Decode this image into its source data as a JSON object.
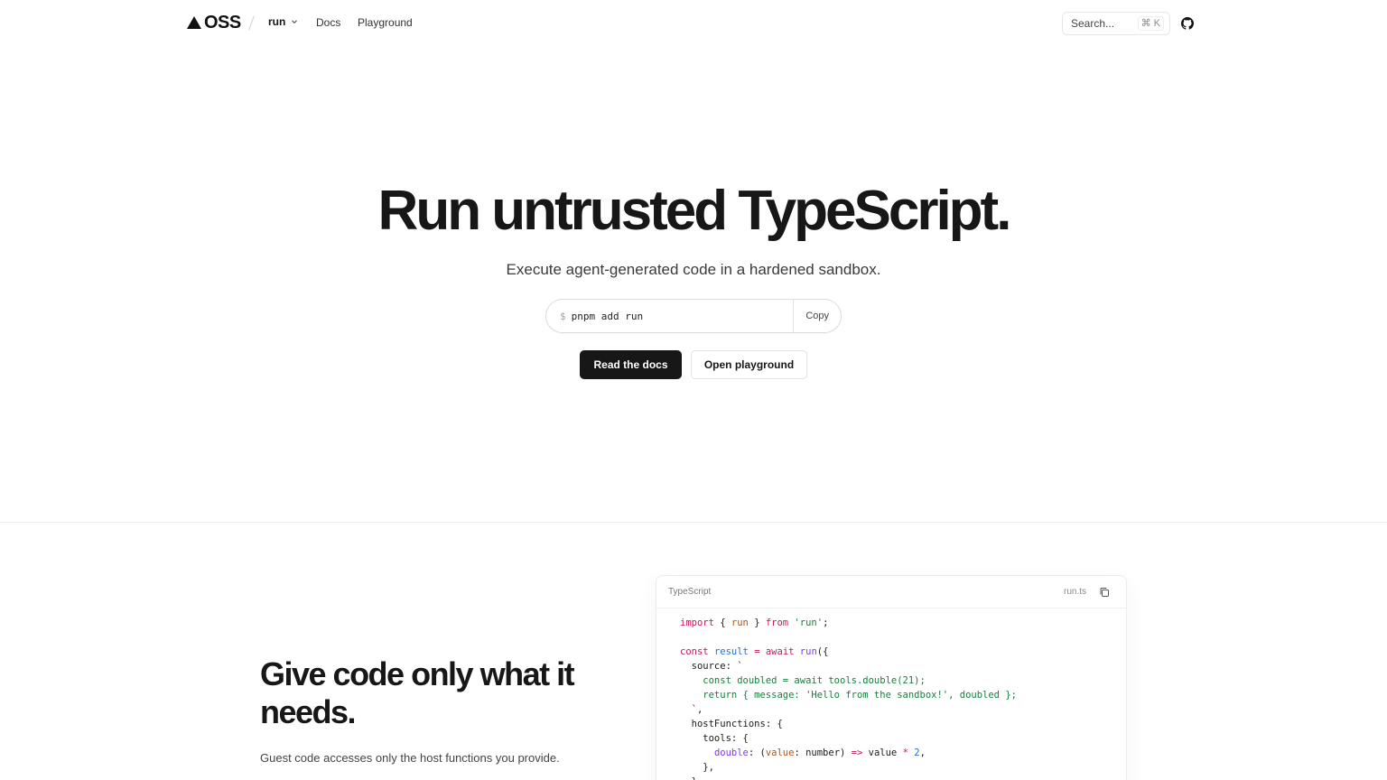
{
  "header": {
    "logo_text": "OSS",
    "project": "run",
    "nav": [
      {
        "label": "Docs"
      },
      {
        "label": "Playground"
      }
    ],
    "search": {
      "placeholder": "Search...",
      "shortcut_mod": "⌘",
      "shortcut_key": "K"
    },
    "github_icon": "github-icon"
  },
  "hero": {
    "title": "Run untrusted TypeScript.",
    "subtitle": "Execute agent-generated code in a hardened sandbox.",
    "install": {
      "prompt": "$",
      "command": "pnpm add run",
      "copy_label": "Copy"
    },
    "primary_cta": "Read the docs",
    "secondary_cta": "Open playground"
  },
  "feature": {
    "title": "Give code only what it needs.",
    "description": "Guest code accesses only the host functions you provide."
  },
  "code_card": {
    "language": "TypeScript",
    "filename": "run.ts",
    "lines": [
      "import { run } from 'run';",
      "",
      "const result = await run({",
      "  source: `",
      "    const doubled = await tools.double(21);",
      "    return { message: 'Hello from the sandbox!', doubled };",
      "  `,",
      "  hostFunctions: {",
      "    tools: {",
      "      double: (value: number) => value * 2,",
      "    },",
      "  },"
    ]
  },
  "colors": {
    "text": "#171717",
    "primary_button": "#171717",
    "keyword": "#c2185b",
    "string": "#15803d",
    "variable": "#b45309"
  }
}
